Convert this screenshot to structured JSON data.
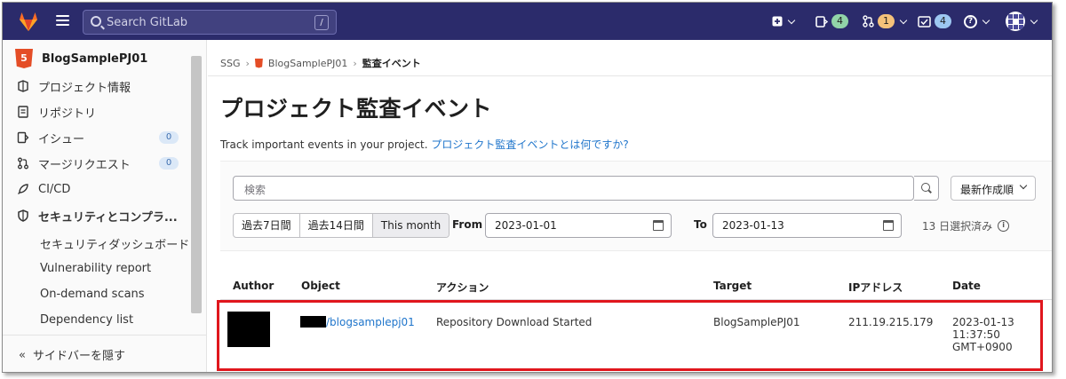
{
  "topbar": {
    "search_placeholder": "Search GitLab",
    "search_shortcut": "/",
    "issues_count": "4",
    "merge_requests_count": "1",
    "todos_count": "4",
    "help_symbol": "?",
    "colors": {
      "background": "#2b2b6b",
      "gitlab_logo": "#fc6d26"
    },
    "icons": [
      "gitlab-logo-icon",
      "hamburger-icon",
      "search-icon",
      "plus-square-icon",
      "issues-icon",
      "merge-request-icon",
      "todo-icon",
      "help-icon",
      "user-avatar"
    ]
  },
  "sidebar": {
    "project_logo_text": "5",
    "project_name": "BlogSamplePJ01",
    "items": [
      {
        "label": "プロジェクト情報",
        "icon": "project-info-icon"
      },
      {
        "label": "リポジトリ",
        "icon": "document-icon"
      },
      {
        "label": "イシュー",
        "icon": "issues-icon",
        "badge": "0"
      },
      {
        "label": "マージリクエスト",
        "icon": "merge-request-icon",
        "badge": "0"
      },
      {
        "label": "CI/CD",
        "icon": "rocket-icon"
      },
      {
        "label": "セキュリティとコンプラ...",
        "icon": "shield-icon"
      }
    ],
    "sub_items": [
      {
        "label": "セキュリティダッシュボード"
      },
      {
        "label": "Vulnerability report"
      },
      {
        "label": "On-demand scans"
      },
      {
        "label": "Dependency list"
      }
    ],
    "hide_label": "サイドバーを隠す",
    "hide_glyph": "«"
  },
  "breadcrumb": {
    "items": [
      "SSG",
      "BlogSamplePJ01",
      "監査イベント"
    ],
    "separator": "›"
  },
  "page": {
    "title": "プロジェクト監査イベント",
    "description": "Track important events in your project.",
    "help_link": "プロジェクト監査イベントとは何ですか?"
  },
  "filters": {
    "search_placeholder": "検索",
    "sort_label": "最新作成順",
    "ranges": [
      {
        "label": "過去7日間",
        "active": false
      },
      {
        "label": "過去14日間",
        "active": false
      },
      {
        "label": "This month",
        "active": true
      }
    ],
    "from_label": "From",
    "from_value": "2023-01-01",
    "to_label": "To",
    "to_value": "2023-01-13",
    "selected_days": "13 日選択済み",
    "info_symbol": "i"
  },
  "table": {
    "columns": [
      "Author",
      "Object",
      "アクション",
      "Target",
      "IPアドレス",
      "Date"
    ],
    "rows": [
      {
        "author": "",
        "object_suffix": "/blogsamplepj01",
        "action": "Repository Download Started",
        "target": "BlogSamplePJ01",
        "ip": "211.19.215.179",
        "date_line1": "2023-01-13",
        "date_line2": "11:37:50",
        "date_line3": "GMT+0900"
      }
    ],
    "highlight_color": "#e0161d"
  }
}
